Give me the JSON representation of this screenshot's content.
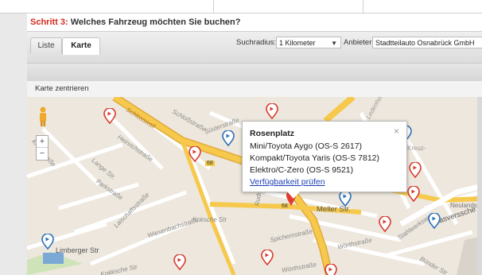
{
  "step": {
    "prefix": "Schritt 3:",
    "question": "Welches Fahrzeug möchten Sie buchen?"
  },
  "tabs": [
    {
      "label": "Liste",
      "active": false
    },
    {
      "label": "Karte",
      "active": true
    }
  ],
  "filters": {
    "radius_label": "Suchradius:",
    "radius_value": "1 Kilometer",
    "provider_label": "Anbieter:",
    "provider_value": "Stadtteilauto Osnabrück GmbH"
  },
  "map_controls": {
    "center_label": "Karte zentrieren",
    "zoom_in": "+",
    "zoom_out": "−"
  },
  "popup": {
    "title": "Rosenplatz",
    "lines": [
      "Mini/Toyota Aygo (OS-S 2617)",
      "Kompakt/Toyota Yaris (OS-S 7812)",
      "Elektro/C-Zero (OS-S 9521)"
    ],
    "link": "Verfügbarkeit prüfen",
    "close": "×"
  },
  "map_labels": {
    "schlosswall": "Schlosswall",
    "schlossstrasse": "Schloßstraße",
    "suesterstrasse": "Süsterstraße",
    "heinrichstrasse": "Heinrichstraße",
    "langestr": "Lange Str.",
    "parkstrasse": "Parkstraße",
    "laischaftsstrasse": "Laischaftsstraße",
    "kronwstrasse": "Kromstraße",
    "wiesenbachstrasse": "Wiesenbachstraße",
    "kokschestr": "Koksche Str",
    "kokschestr2": "Kokksche Str",
    "rudolfstrasse": "Rudolfstraße",
    "spichernstrasse": "Spichernstraße",
    "meller": "Meller Str.",
    "limberger": "Limberger Str",
    "worthstrasse": "Wörthstraße",
    "worthstrasse2": "Wörthstraße",
    "neulandstr": "Neulandstr",
    "bunder": "Bünder Str",
    "hasevers": "Hasverssche Str",
    "stahlwerksweg": "Stahlwerksweg",
    "ledenhof": "Ledenhof",
    "road68a": "68",
    "road68b": "68",
    "road68c": "68",
    "kreuz": "Kreuz-"
  },
  "colors": {
    "accent_red": "#d32b1e",
    "marker_red": "#d83a2e",
    "marker_blue": "#2c6fb7",
    "road_yellow": "#f6c94c",
    "link_blue": "#1a3fb5"
  }
}
